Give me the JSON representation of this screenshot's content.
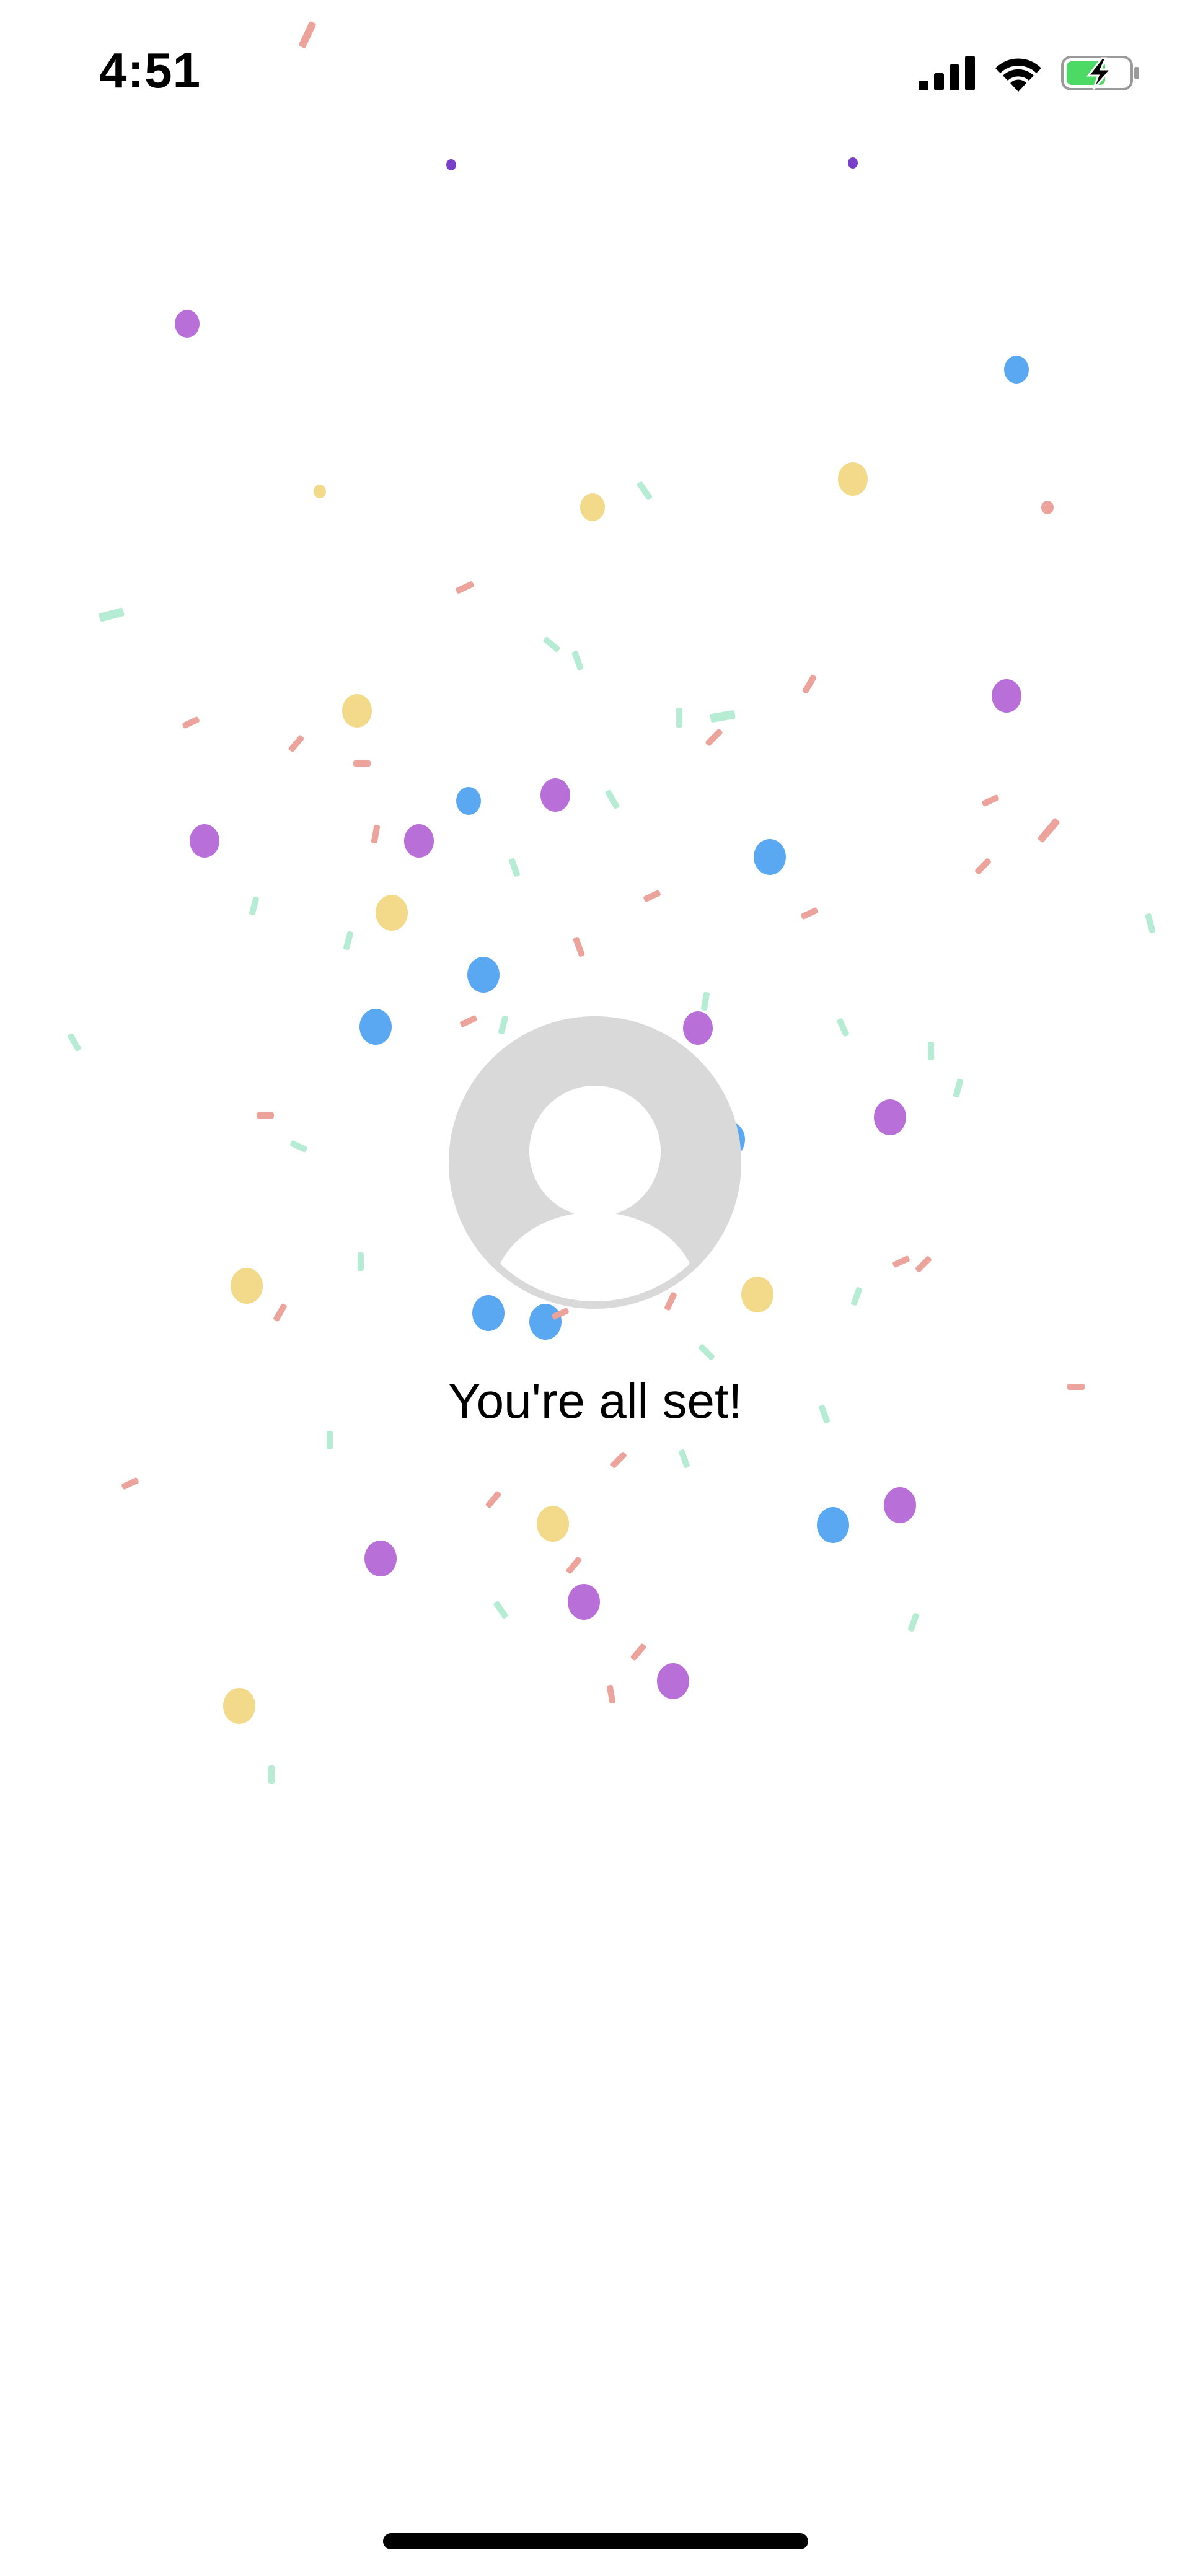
{
  "status_bar": {
    "time": "4:51",
    "icons": [
      "cellular-signal-icon",
      "wifi-icon",
      "battery-charging-icon"
    ],
    "battery_color": "#4cd964"
  },
  "avatar": {
    "icon": "user-placeholder-icon",
    "background_color": "#d9d9d9"
  },
  "message": "You're all set!",
  "confetti": {
    "colors": {
      "purple": "#b870d8",
      "blue": "#5aa8f2",
      "yellow": "#f3d98a",
      "salmon": "#eba39b",
      "mint": "#b6ecd3",
      "violet": "#7a3fc8"
    }
  }
}
